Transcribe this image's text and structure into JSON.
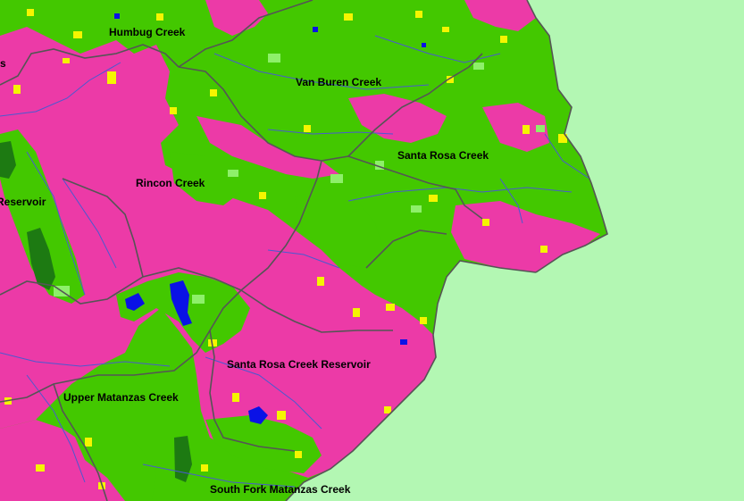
{
  "colors": {
    "background_outside": "#b3f7b3",
    "urban_developed": "#ec3aa7",
    "forest_vegetation": "#43c800",
    "light_vegetation": "#8ef06a",
    "agriculture_yellow": "#f5f500",
    "dense_forest": "#1d7a12",
    "water": "#0a12e6",
    "stream_lines": "#4a5ad0",
    "watershed_boundaries": "#555555"
  },
  "labels": {
    "humbug": "Humbug Creek",
    "vanburen": "Van Buren Creek",
    "santarosa": "Santa Rosa Creek",
    "rincon": "Rincon Creek",
    "reservoir_left": "Reservoir",
    "cut_left": "s",
    "sr_reservoir": "Santa Rosa Creek Reservoir",
    "upper_matanzas": "Upper Matanzas Creek",
    "south_fork": "South Fork Matanzas Creek"
  }
}
